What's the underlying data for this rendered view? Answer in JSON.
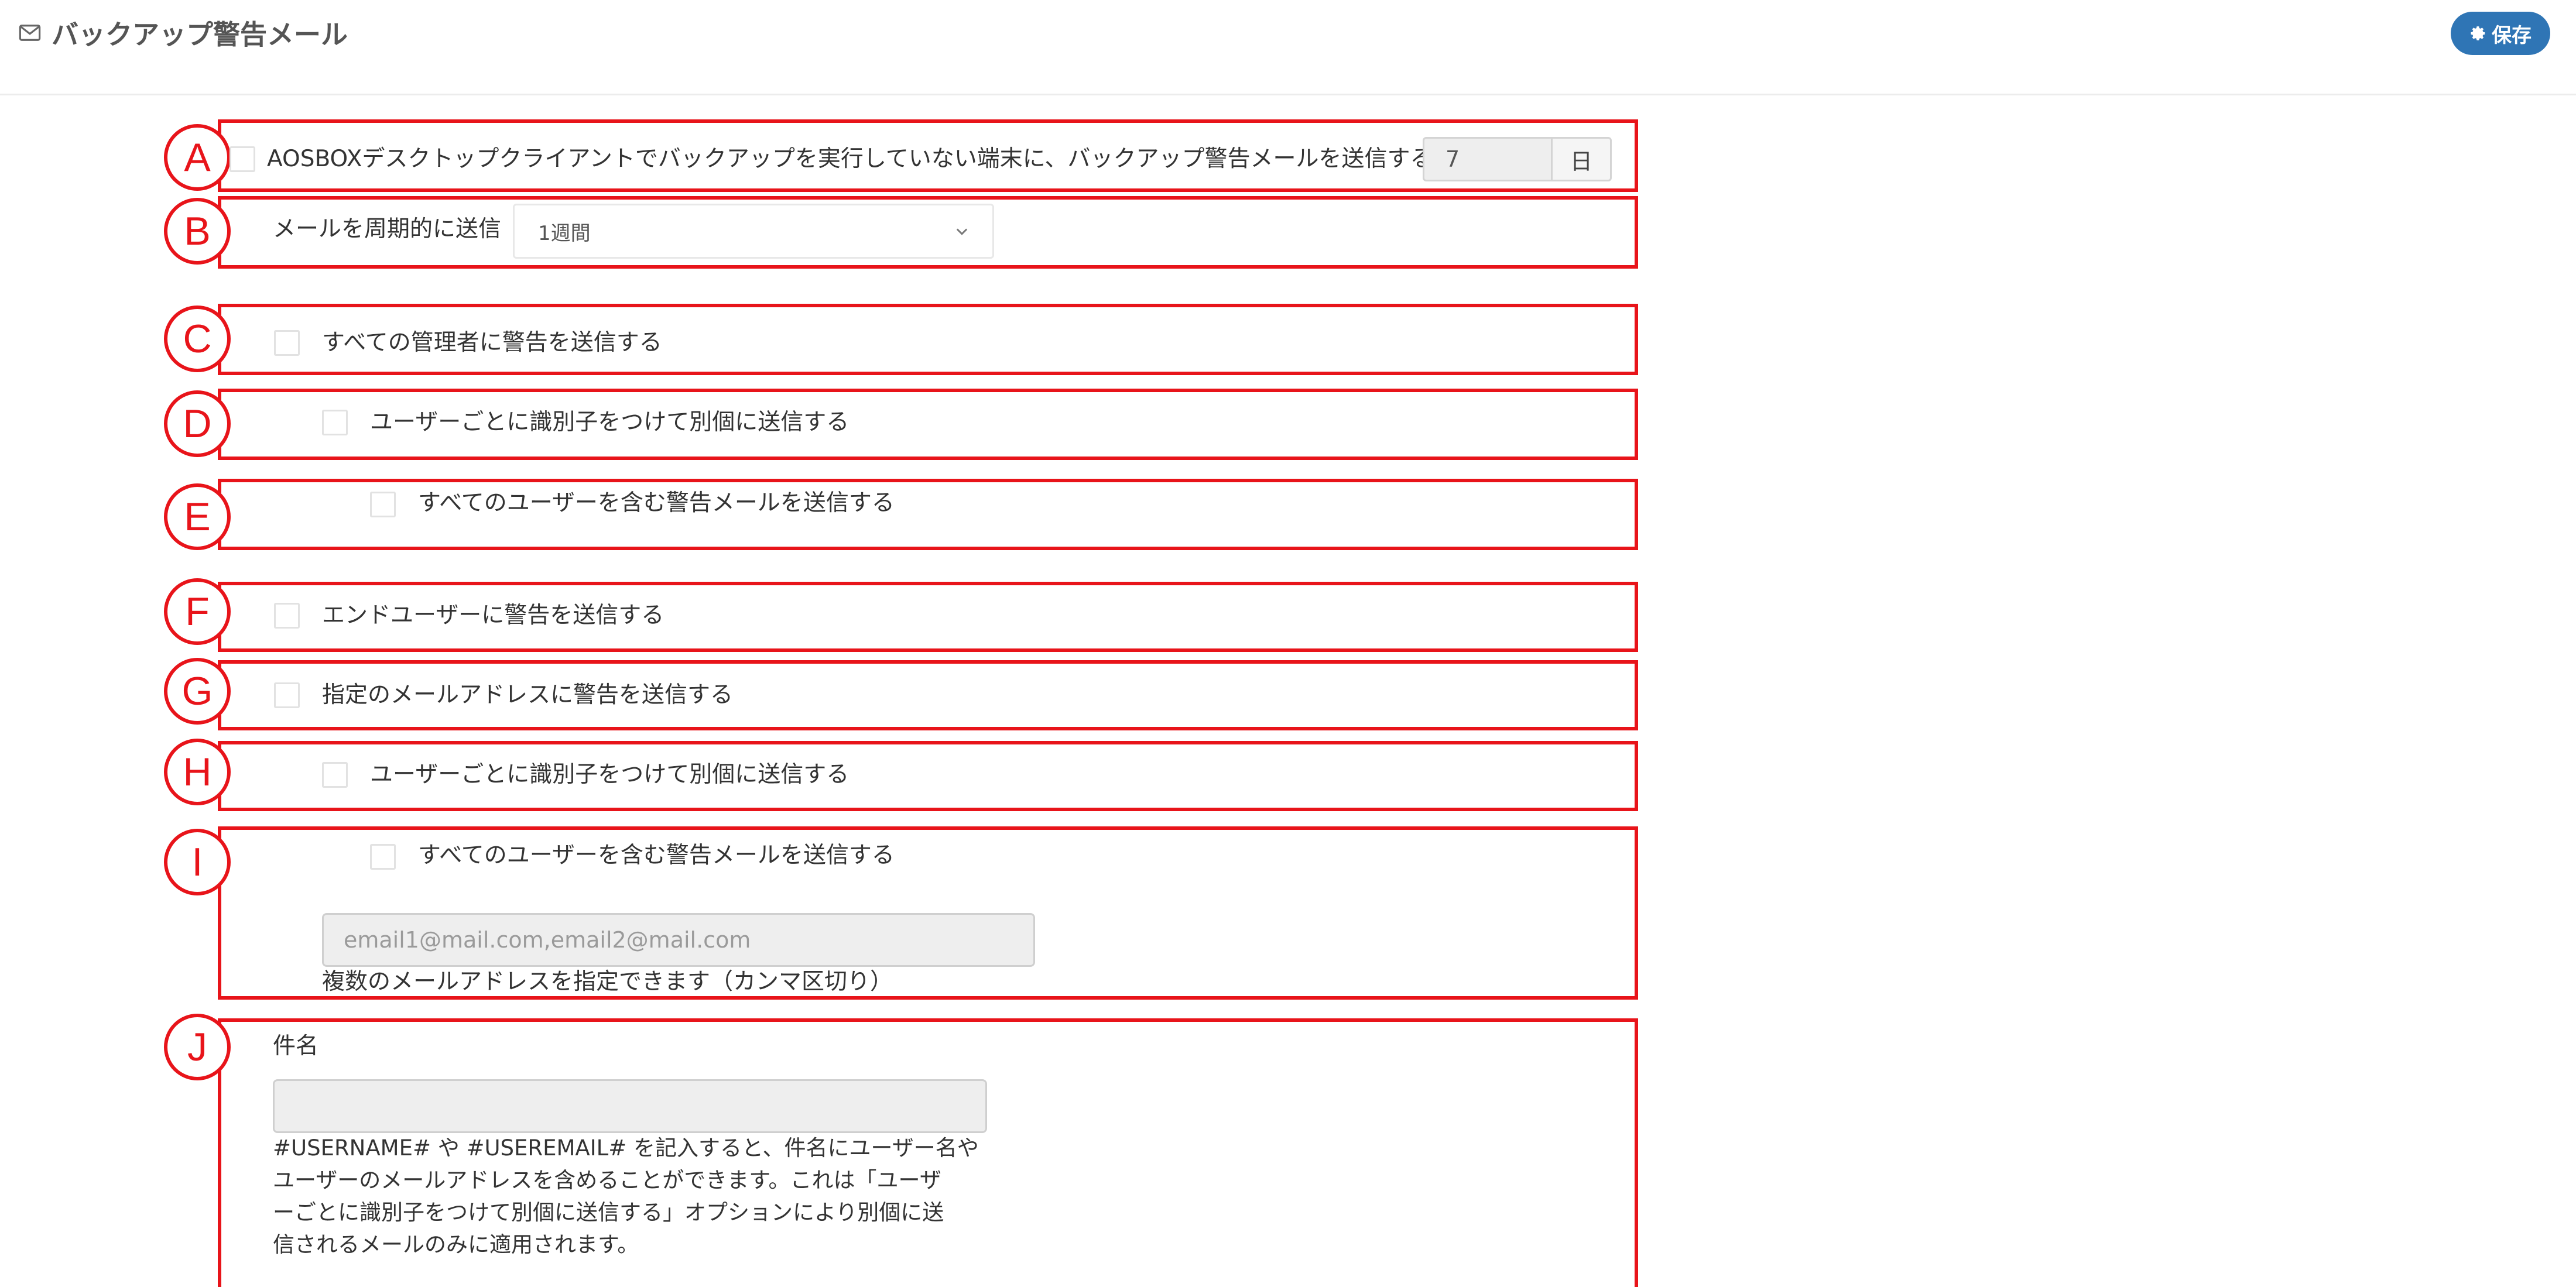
{
  "header": {
    "title": "バックアップ警告メール",
    "save_label": "保存",
    "icons": {
      "title": "envelope-icon",
      "save": "gear-icon"
    },
    "accent_color": "#2f75b5"
  },
  "annotation_color": "#e8141a",
  "sections": {
    "A": {
      "marker": "A",
      "label": "AOSBOXデスクトップクライアントでバックアップを実行していない端末に、バックアップ警告メールを送信する",
      "days_value": "7",
      "days_unit": "日"
    },
    "B": {
      "marker": "B",
      "label": "メールを周期的に送信",
      "selected": "1週間"
    },
    "C": {
      "marker": "C",
      "label": "すべての管理者に警告を送信する"
    },
    "D": {
      "marker": "D",
      "label": "ユーザーごとに識別子をつけて別個に送信する"
    },
    "E": {
      "marker": "E",
      "label": "すべてのユーザーを含む警告メールを送信する"
    },
    "F": {
      "marker": "F",
      "label": "エンドユーザーに警告を送信する"
    },
    "G": {
      "marker": "G",
      "label": "指定のメールアドレスに警告を送信する"
    },
    "H": {
      "marker": "H",
      "label": "ユーザーごとに識別子をつけて別個に送信する"
    },
    "I": {
      "marker": "I",
      "label": "すべてのユーザーを含む警告メールを送信する",
      "email_placeholder": "email1@mail.com,email2@mail.com",
      "help": "複数のメールアドレスを指定できます（カンマ区切り）"
    },
    "J": {
      "marker": "J",
      "label": "件名",
      "subject_value": "",
      "help_lines": [
        "#USERNAME# や #USEREMAIL# を記入すると、件名にユーザー名や",
        "ユーザーのメールアドレスを含めることができます。これは「ユーザ",
        "ーごとに識別子をつけて別個に送信する」オプションにより別個に送",
        "信されるメールのみに適用されます。"
      ]
    }
  }
}
